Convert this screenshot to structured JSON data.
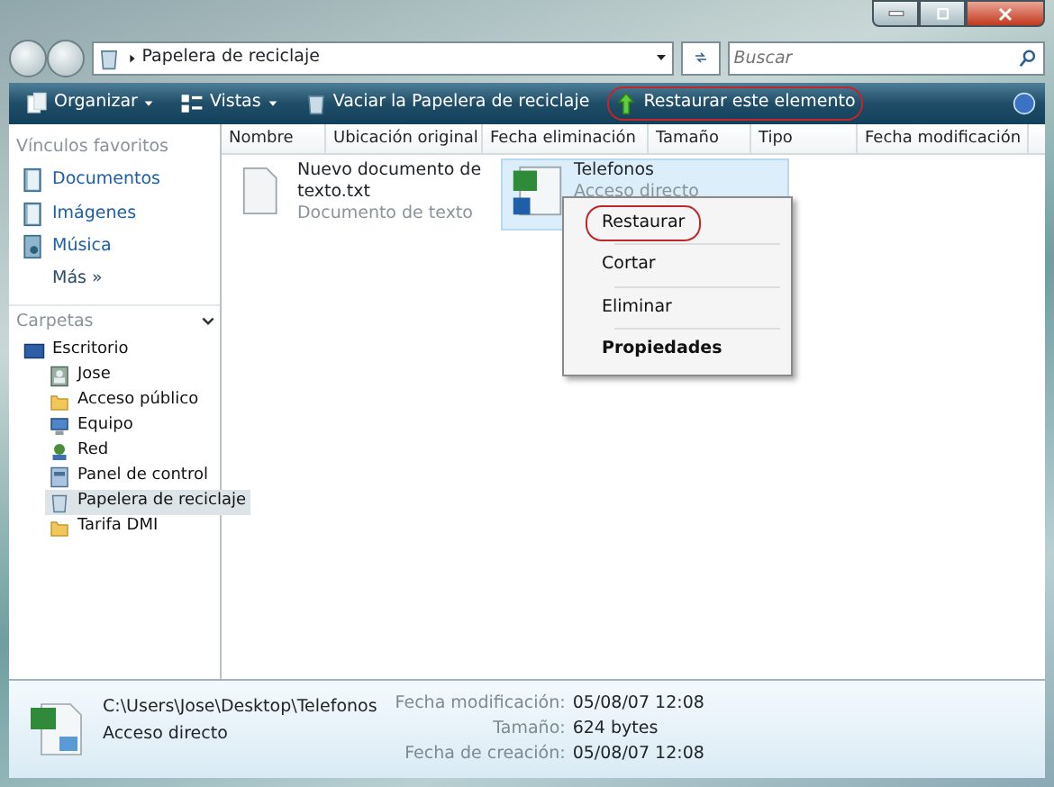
{
  "address": {
    "location": "Papelera de reciclaje",
    "search_placeholder": "Buscar"
  },
  "toolbar": [
    {
      "label": "Organizar",
      "dropdown": true,
      "circled": false
    },
    {
      "label": "Vistas",
      "dropdown": true,
      "circled": false
    },
    {
      "label": "Vaciar la Papelera de reciclaje",
      "dropdown": false,
      "circled": false
    },
    {
      "label": "Restaurar este elemento",
      "dropdown": false,
      "circled": true
    }
  ],
  "favorites": {
    "title": "Vínculos favoritos",
    "items": [
      {
        "label": "Documentos"
      },
      {
        "label": "Imágenes"
      },
      {
        "label": "Música"
      }
    ],
    "more": "Más",
    "more_glyph": "»"
  },
  "folders": {
    "title": "Carpetas",
    "tree": [
      {
        "label": "Escritorio",
        "selected": false,
        "children": [
          {
            "label": "Jose",
            "selected": false
          },
          {
            "label": "Acceso público",
            "selected": false
          },
          {
            "label": "Equipo",
            "selected": false
          },
          {
            "label": "Red",
            "selected": false
          },
          {
            "label": "Panel de control",
            "selected": false
          },
          {
            "label": "Papelera de reciclaje",
            "selected": true
          },
          {
            "label": "Tarifa DMI",
            "selected": false
          }
        ]
      }
    ]
  },
  "columns": [
    "Nombre",
    "Ubicación original",
    "Fecha eliminación",
    "Tamaño",
    "Tipo",
    "Fecha modificación"
  ],
  "files": [
    {
      "name": "Nuevo documento de texto.txt",
      "type": "Documento de texto",
      "kind": "text",
      "selected": false
    },
    {
      "name": "Telefonos",
      "type": "Acceso directo",
      "kind": "shortcut",
      "selected": true
    }
  ],
  "context_menu": [
    {
      "label": "Restaurar",
      "bold": false,
      "circled": true
    },
    {
      "label": "Cortar",
      "bold": false,
      "circled": false
    },
    {
      "label": "Eliminar",
      "bold": false,
      "circled": false
    },
    {
      "label": "Propiedades",
      "bold": true,
      "circled": false
    }
  ],
  "details": {
    "path": "C:\\Users\\Jose\\Desktop\\Telefonos",
    "type": "Acceso directo",
    "fields": [
      {
        "label": "Fecha modificación:",
        "value": "05/08/07 12:08"
      },
      {
        "label": "Tamaño:",
        "value": "624 bytes"
      },
      {
        "label": "Fecha de creación:",
        "value": "05/08/07 12:08"
      }
    ]
  }
}
